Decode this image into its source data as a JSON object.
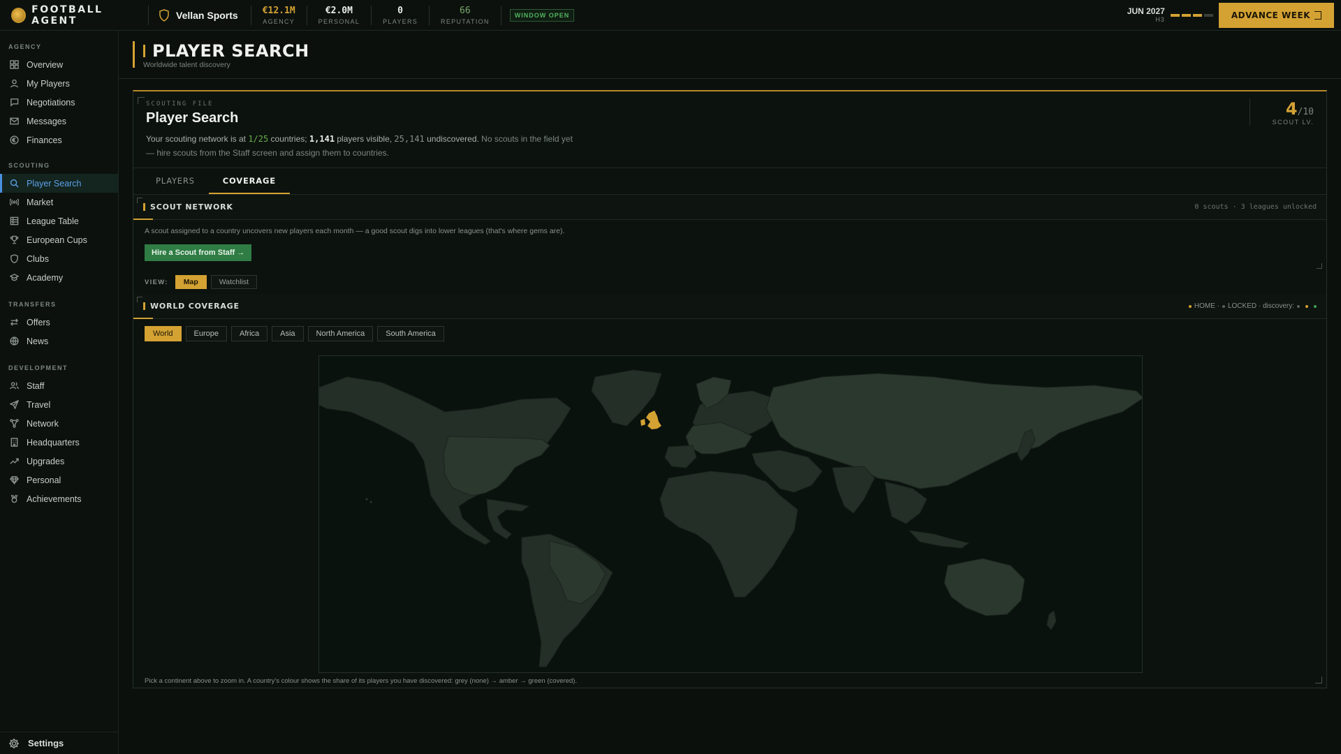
{
  "brand": {
    "name": "FOOTBALL AGENT"
  },
  "club": {
    "name": "Vellan Sports"
  },
  "stats": [
    {
      "value": "€12.1M",
      "label": "AGENCY",
      "tone": "gold"
    },
    {
      "value": "€2.0M",
      "label": "PERSONAL",
      "tone": "white"
    },
    {
      "value": "0",
      "label": "PLAYERS",
      "tone": "white"
    },
    {
      "value": "66",
      "label": "REPUTATION",
      "tone": "green"
    }
  ],
  "window_status": "WINDOW OPEN",
  "date": {
    "main": "JUN 2027",
    "sub": "H3"
  },
  "week_progress": {
    "filled": 3,
    "total": 4
  },
  "advance_label": "ADVANCE WEEK",
  "sidebar": {
    "sections": [
      {
        "title": "AGENCY",
        "items": [
          {
            "label": "Overview",
            "icon": "grid-icon"
          },
          {
            "label": "My Players",
            "icon": "user-icon"
          },
          {
            "label": "Negotiations",
            "icon": "chat-icon"
          },
          {
            "label": "Messages",
            "icon": "mail-icon"
          },
          {
            "label": "Finances",
            "icon": "coin-icon"
          }
        ]
      },
      {
        "title": "SCOUTING",
        "items": [
          {
            "label": "Player Search",
            "icon": "search-icon",
            "active": true
          },
          {
            "label": "Market",
            "icon": "broadcast-icon"
          },
          {
            "label": "League Table",
            "icon": "table-icon"
          },
          {
            "label": "European Cups",
            "icon": "trophy-icon"
          },
          {
            "label": "Clubs",
            "icon": "shield-icon"
          },
          {
            "label": "Academy",
            "icon": "graduation-icon"
          }
        ]
      },
      {
        "title": "TRANSFERS",
        "items": [
          {
            "label": "Offers",
            "icon": "swap-icon"
          },
          {
            "label": "News",
            "icon": "globe-icon"
          }
        ]
      },
      {
        "title": "DEVELOPMENT",
        "items": [
          {
            "label": "Staff",
            "icon": "staff-icon"
          },
          {
            "label": "Travel",
            "icon": "plane-icon"
          },
          {
            "label": "Network",
            "icon": "network-icon"
          },
          {
            "label": "Headquarters",
            "icon": "building-icon"
          },
          {
            "label": "Upgrades",
            "icon": "trend-icon"
          },
          {
            "label": "Personal",
            "icon": "diamond-icon"
          },
          {
            "label": "Achievements",
            "icon": "medal-icon"
          }
        ]
      }
    ],
    "settings_label": "Settings"
  },
  "page": {
    "title": "PLAYER SEARCH",
    "subtitle": "Worldwide talent discovery"
  },
  "file": {
    "label": "SCOUTING FILE",
    "title": "Player Search",
    "desc_1": "Your scouting network is at ",
    "countries": "1/25",
    "desc_2": " countries; ",
    "visible": "1,141",
    "desc_3": " players visible, ",
    "undiscovered": "25,141",
    "desc_4": " undiscovered. ",
    "desc_5": "No scouts in the field yet — hire scouts from the Staff screen and assign them to countries.",
    "scout_level": "4",
    "scout_level_max": "/10",
    "scout_level_label": "SCOUT LV."
  },
  "tabs": [
    {
      "label": "PLAYERS",
      "active": false
    },
    {
      "label": "COVERAGE",
      "active": true
    }
  ],
  "network": {
    "title": "SCOUT NETWORK",
    "meta": "0 scouts · 3 leagues unlocked",
    "desc": "A scout assigned to a country uncovers new players each month — a good scout digs into lower leagues (that's where gems are).",
    "hire_label": "Hire a Scout from Staff →",
    "view_label": "VIEW:",
    "views": [
      {
        "label": "Map",
        "active": true
      },
      {
        "label": "Watchlist",
        "active": false
      }
    ]
  },
  "coverage": {
    "title": "WORLD COVERAGE",
    "legend_home": "HOME ·",
    "legend_locked": "LOCKED · discovery:",
    "colors": {
      "home": "#d4a233",
      "locked": "#5a625b",
      "none": "#5a625b",
      "partial": "#d4a233",
      "covered": "#3fa14f"
    },
    "continents": [
      {
        "label": "World",
        "active": true
      },
      {
        "label": "Europe",
        "active": false
      },
      {
        "label": "Africa",
        "active": false
      },
      {
        "label": "Asia",
        "active": false
      },
      {
        "label": "North America",
        "active": false
      },
      {
        "label": "South America",
        "active": false
      }
    ],
    "footnote": "Pick a continent above to zoom in. A country's colour shows the share of its players you have discovered: grey (none) → amber → green (covered)."
  }
}
